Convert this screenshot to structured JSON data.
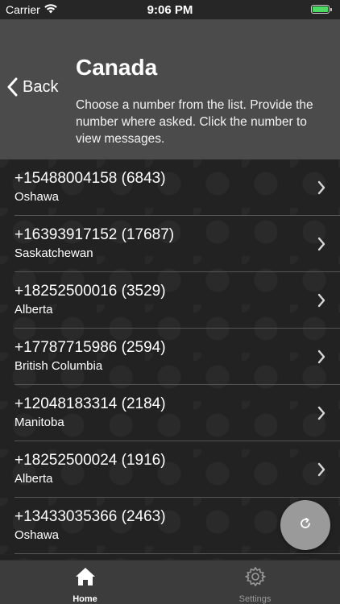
{
  "status_bar": {
    "carrier": "Carrier",
    "time": "9:06 PM",
    "battery_color": "#4cd964"
  },
  "header": {
    "back_label": "Back",
    "title": "Canada",
    "description": "Choose a number from the list. Provide the number where asked. Click the number to view messages."
  },
  "numbers": [
    {
      "number": "+15488004158 (6843)",
      "city": "Oshawa"
    },
    {
      "number": "+16393917152 (17687)",
      "city": "Saskatchewan"
    },
    {
      "number": "+18252500016 (3529)",
      "city": "Alberta"
    },
    {
      "number": "+17787715986 (2594)",
      "city": "British Columbia"
    },
    {
      "number": "+12048183314 (2184)",
      "city": "Manitoba"
    },
    {
      "number": "+18252500024 (1916)",
      "city": "Alberta"
    },
    {
      "number": "+13433035366 (2463)",
      "city": "Oshawa"
    }
  ],
  "fab": {
    "icon": "refresh-icon"
  },
  "tabs": [
    {
      "label": "Home",
      "icon": "home-icon",
      "active": true
    },
    {
      "label": "Settings",
      "icon": "gear-icon",
      "active": false
    }
  ],
  "colors": {
    "header_bg": "#4b4b4b",
    "list_bg": "#222222",
    "tab_bar_bg": "#3c3c3c",
    "fab_bg": "#9a9a9a"
  }
}
